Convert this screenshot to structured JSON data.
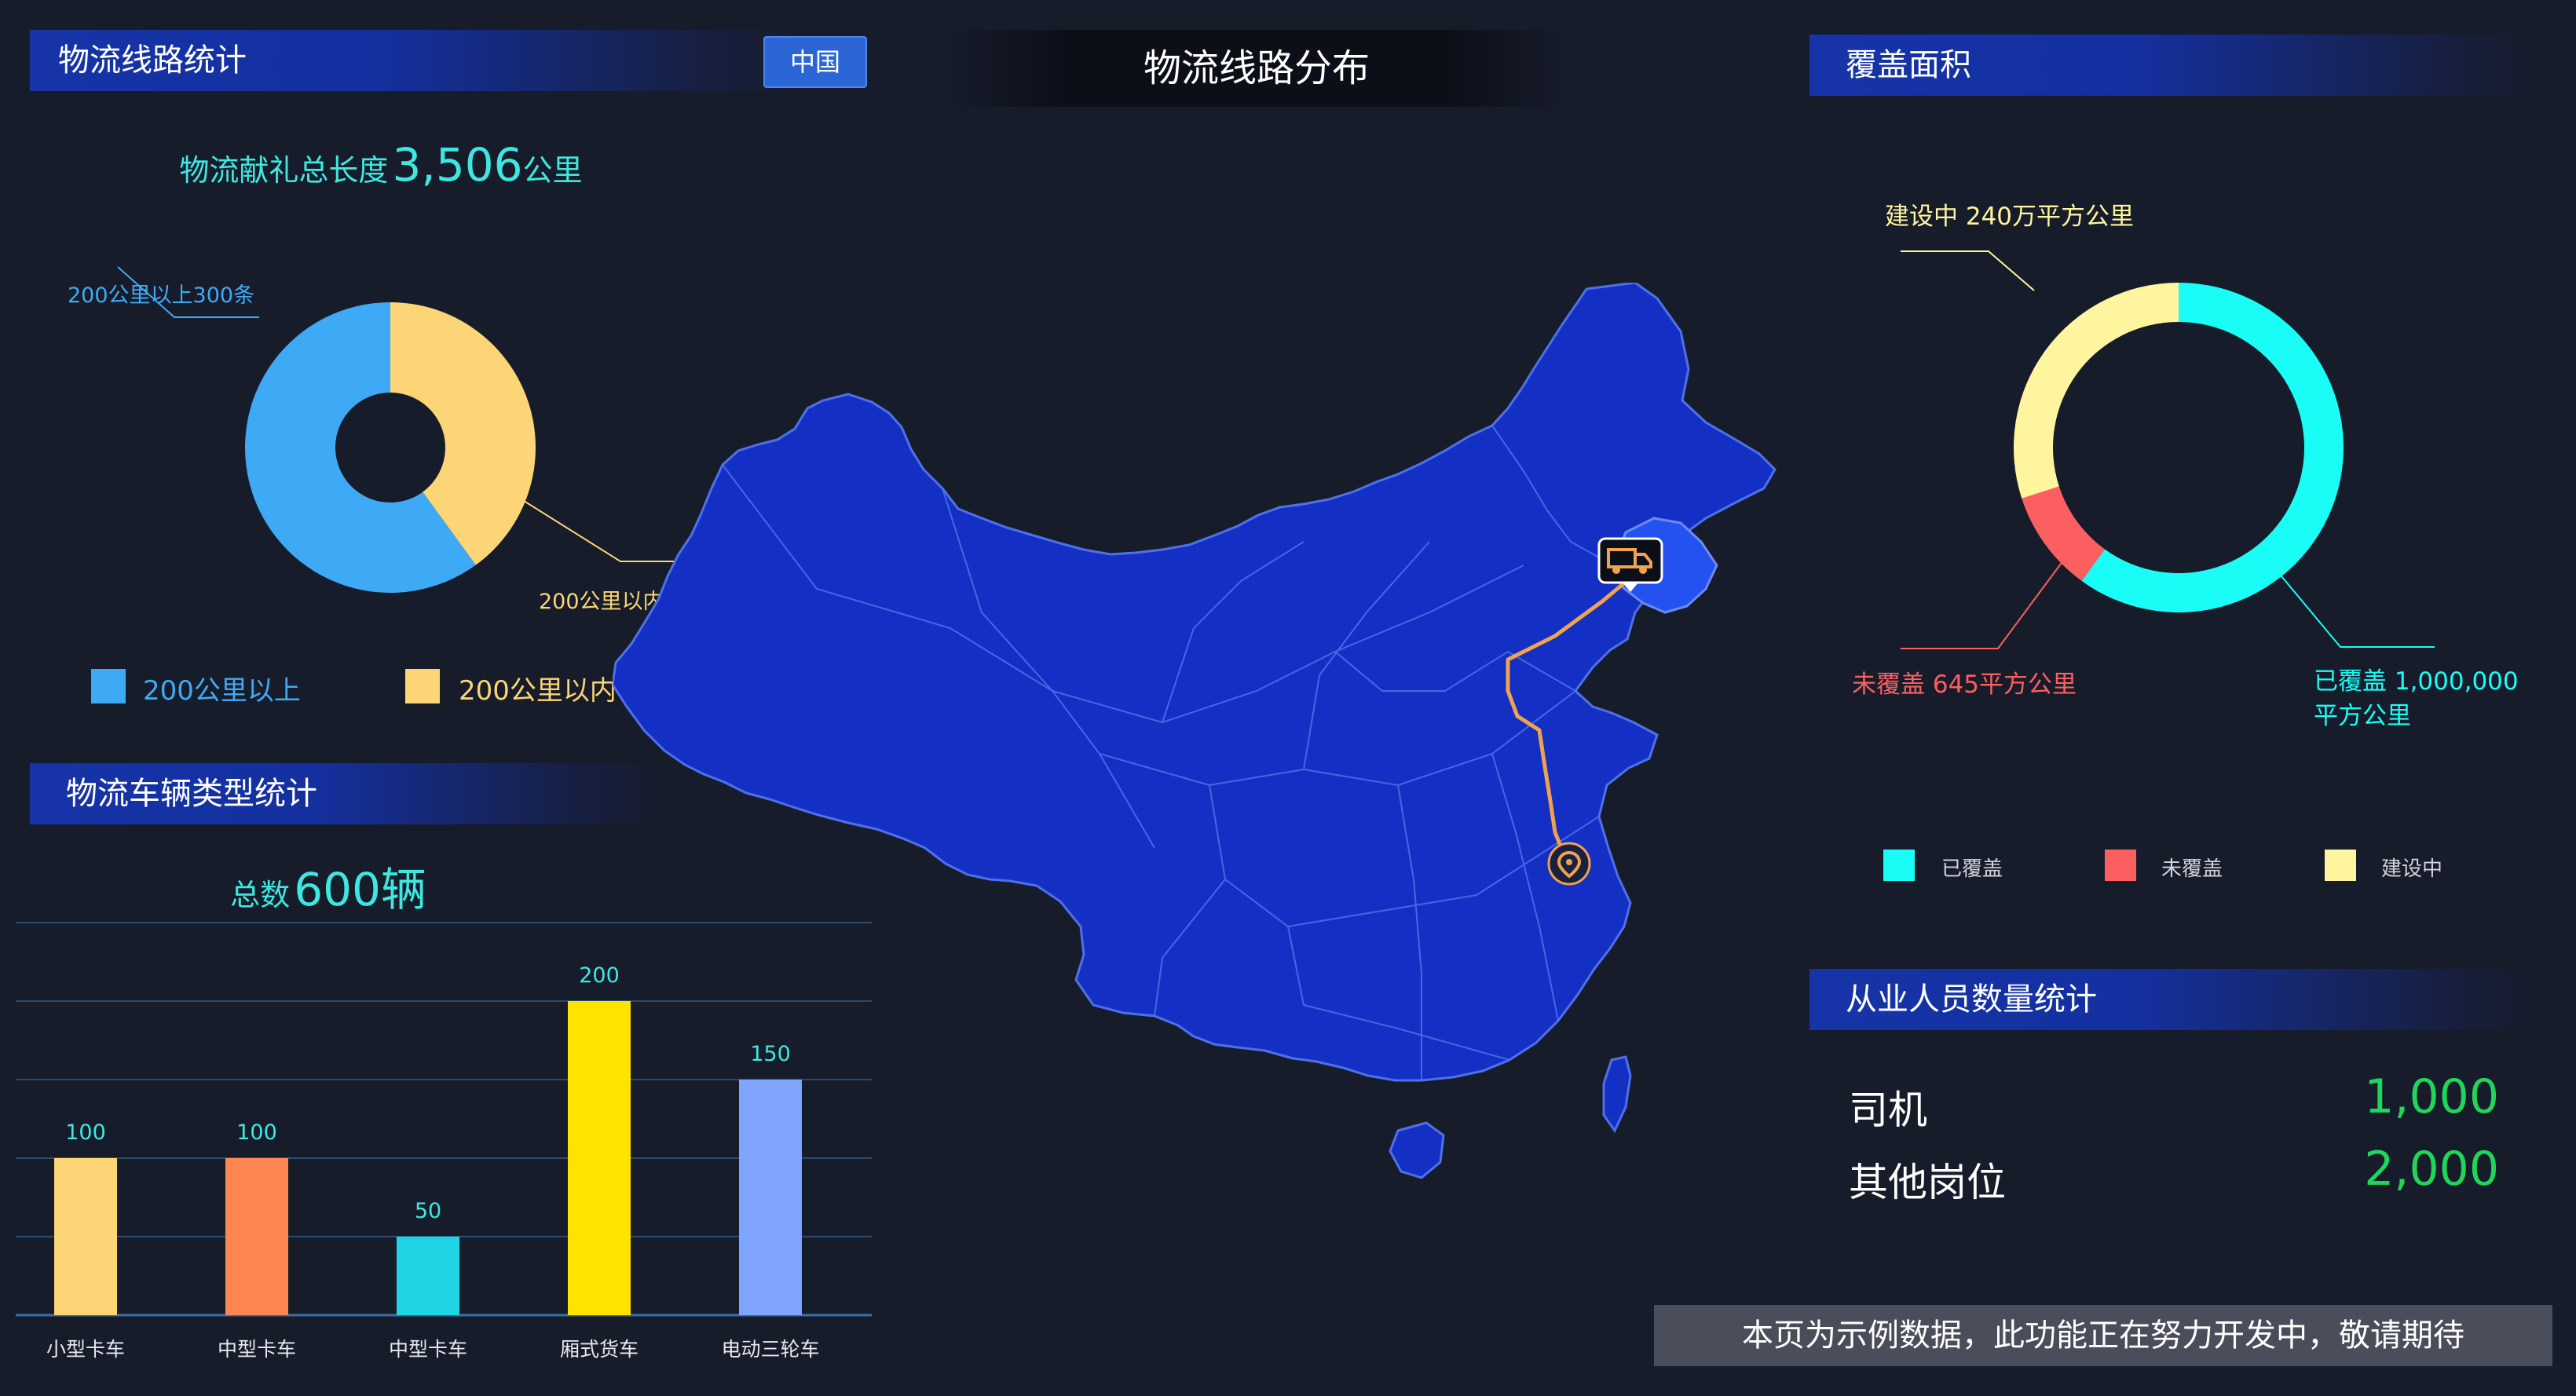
{
  "header": {
    "title": "物流线路分布",
    "region_button": "中国"
  },
  "routes_panel": {
    "title": "物流线路统计",
    "total_prefix": "物流献礼总长度",
    "total_value": "3,506",
    "total_unit": "公里",
    "callout_over": "200公里以上300条",
    "callout_under": "200公里以内 200条",
    "legend": [
      {
        "label": "200公里以上",
        "color": "#3eaaf5"
      },
      {
        "label": "200公里以内",
        "color": "#fbd576"
      }
    ]
  },
  "vehicles_panel": {
    "title": "物流车辆类型统计",
    "total_prefix": "总数",
    "total_value": "600辆"
  },
  "coverage_panel": {
    "title": "覆盖面积",
    "callout_building": "建设中 240万平方公里",
    "callout_uncovered": "未覆盖 645平方公里",
    "callout_covered_1": "已覆盖 1,000,000",
    "callout_covered_2": "平方公里",
    "legend": [
      {
        "label": "已覆盖",
        "color": "#19fdf6"
      },
      {
        "label": "未覆盖",
        "color": "#fc5f5f"
      },
      {
        "label": "建设中",
        "color": "#fff59e"
      }
    ]
  },
  "staff_panel": {
    "title": "从业人员数量统计",
    "rows": [
      {
        "label": "司机",
        "value": "1,000"
      },
      {
        "label": "其他岗位",
        "value": "2,000"
      }
    ]
  },
  "map": {
    "fill_color": "#1430c4",
    "highlight_color": "#2352f0",
    "route_color": "#f0a24e",
    "origin_icon": "truck-icon",
    "destination_icon": "location-pin-icon"
  },
  "footer": {
    "note": "本页为示例数据，此功能正在努力开发中，敬请期待"
  },
  "chart_data": [
    {
      "type": "pie",
      "categories": [
        "200公里以上",
        "200公里以内"
      ],
      "values": [
        300,
        200
      ],
      "colors": [
        "#3eaaf5",
        "#fbd576"
      ]
    },
    {
      "type": "bar",
      "categories": [
        "小型卡车",
        "中型卡车",
        "中型卡车",
        "厢式货车",
        "电动三轮车"
      ],
      "values": [
        100,
        100,
        50,
        200,
        150
      ],
      "colors": [
        "#fbd576",
        "#fd8653",
        "#21d4e4",
        "#ffe300",
        "#7fa5ff"
      ],
      "ylim": [
        0,
        250
      ],
      "grid": true
    },
    {
      "type": "pie",
      "categories": [
        "已覆盖",
        "未覆盖",
        "建设中"
      ],
      "values": [
        1000000,
        645,
        2400000
      ],
      "display_shares": [
        0.6,
        0.1,
        0.3
      ],
      "colors": [
        "#19fdf6",
        "#fc5f5f",
        "#fff59e"
      ]
    }
  ]
}
